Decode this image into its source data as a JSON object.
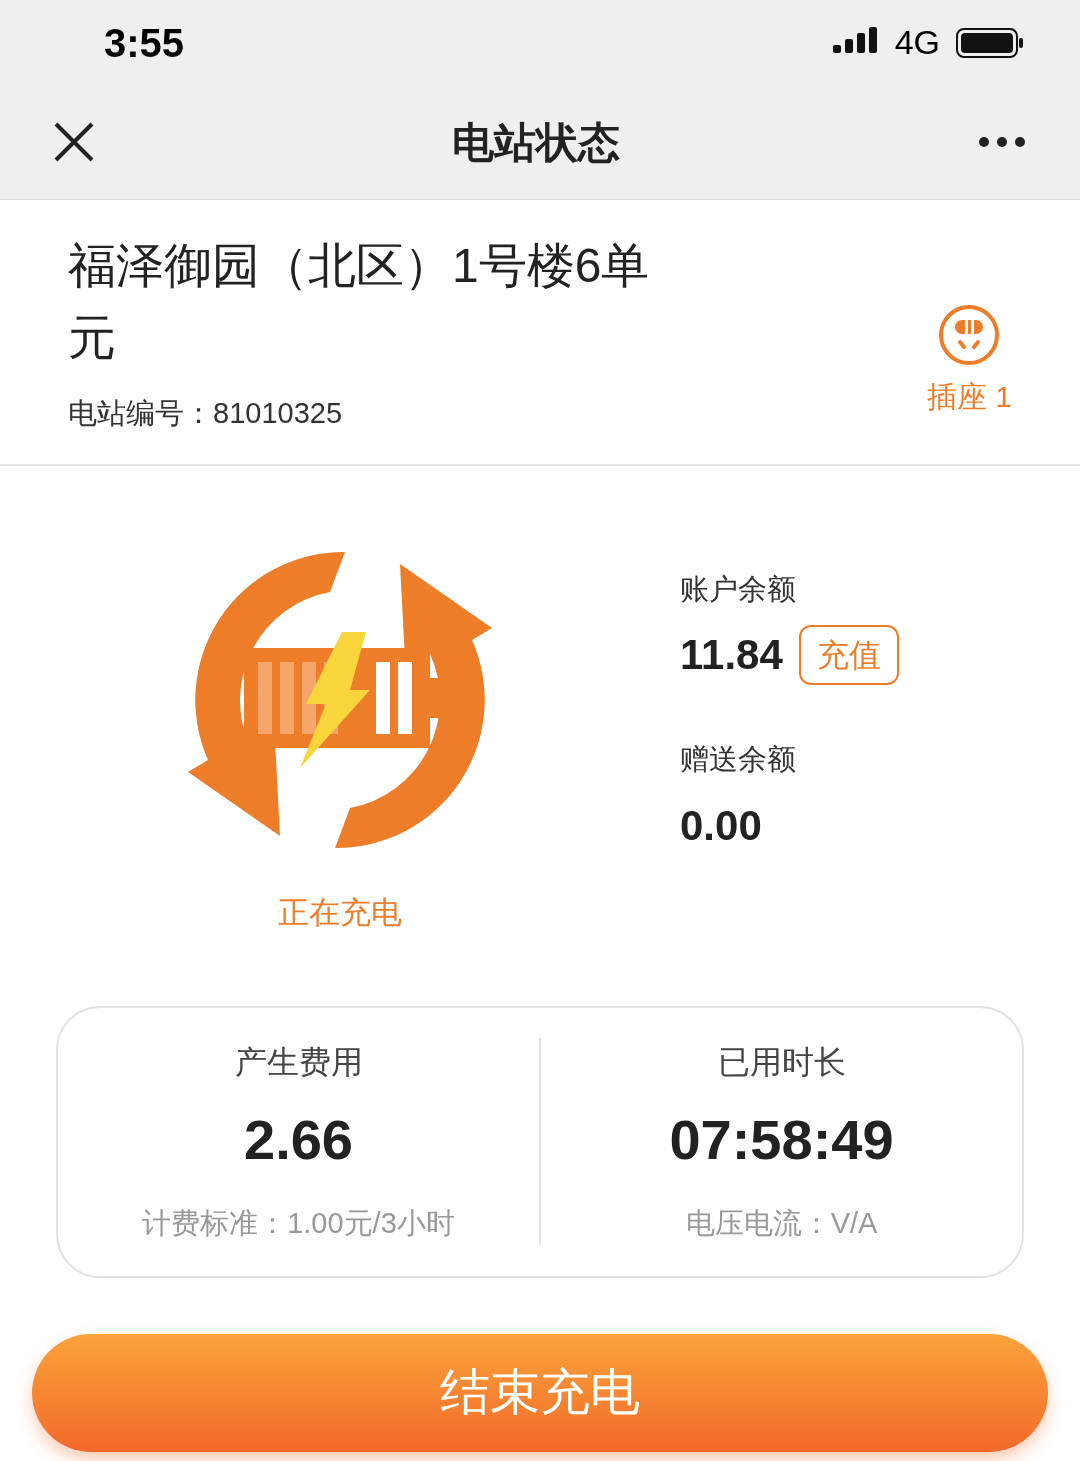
{
  "status_bar": {
    "time": "3:55",
    "network": "4G"
  },
  "nav": {
    "title": "电站状态"
  },
  "station": {
    "name": "福泽御园（北区）1号楼6单元",
    "number": "电站编号：81010325",
    "socket": "插座 1"
  },
  "charging": {
    "status": "正在充电"
  },
  "account": {
    "balance_label": "账户余额",
    "balance": "11.84",
    "recharge_button": "充值",
    "gift_label": "赠送余额",
    "gift_balance": "0.00"
  },
  "stats": [
    {
      "label": "产生费用",
      "value": "2.66",
      "detail": "计费标准：1.00元/3小时"
    },
    {
      "label": "已用时长",
      "value": "07:58:49",
      "detail": "电压电流：V/A"
    }
  ],
  "end_button": "结束充电"
}
